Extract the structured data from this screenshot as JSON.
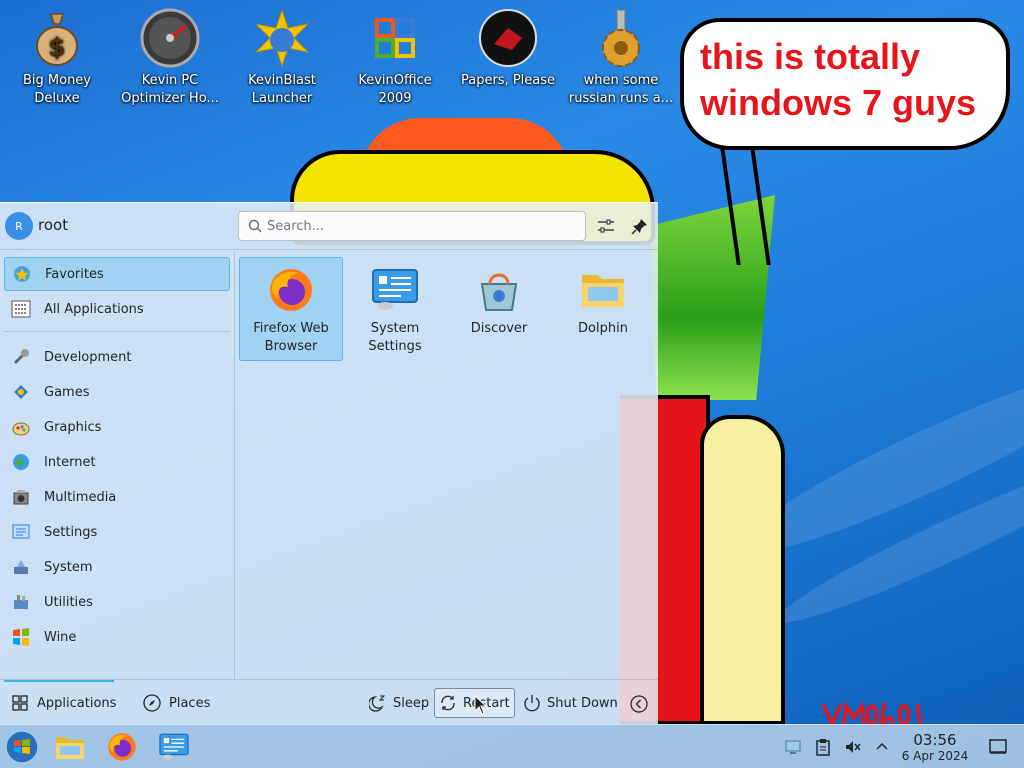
{
  "desktop": {
    "icons": [
      {
        "label": "Big Money\nDeluxe",
        "icon": "money-bag-icon"
      },
      {
        "label": "Kevin PC\nOptimizer Ho...",
        "icon": "gauge-icon"
      },
      {
        "label": "KevinBlast\nLauncher",
        "icon": "sun-star-icon"
      },
      {
        "label": "KevinOffice\n2009",
        "icon": "office-logo-icon"
      },
      {
        "label": "Papers, Please",
        "icon": "papers-please-icon"
      },
      {
        "label": "when some\nrussian runs a...",
        "icon": "gear-icon"
      }
    ],
    "speech_bubble": "this is totally windows 7 guys"
  },
  "menu": {
    "user": {
      "initial": "R",
      "name": "root"
    },
    "search": {
      "placeholder": "Search..."
    },
    "categories": [
      {
        "label": "Favorites",
        "icon": "star-icon",
        "active": true
      },
      {
        "label": "All Applications",
        "icon": "grid-apps-icon"
      },
      {
        "label": "Development",
        "icon": "development-icon"
      },
      {
        "label": "Games",
        "icon": "games-icon"
      },
      {
        "label": "Graphics",
        "icon": "graphics-icon"
      },
      {
        "label": "Internet",
        "icon": "internet-icon"
      },
      {
        "label": "Multimedia",
        "icon": "multimedia-icon"
      },
      {
        "label": "Settings",
        "icon": "settings-icon"
      },
      {
        "label": "System",
        "icon": "system-icon"
      },
      {
        "label": "Utilities",
        "icon": "utilities-icon"
      },
      {
        "label": "Wine",
        "icon": "wine-icon"
      }
    ],
    "favorites": [
      {
        "label": "Firefox Web\nBrowser",
        "icon": "firefox-icon",
        "active": true
      },
      {
        "label": "System\nSettings",
        "icon": "system-settings-icon"
      },
      {
        "label": "Discover",
        "icon": "discover-icon"
      },
      {
        "label": "Dolphin",
        "icon": "folder-icon"
      }
    ],
    "footer": {
      "applications": "Applications",
      "places": "Places",
      "sleep": "Sleep",
      "restart": "Restart",
      "shutdown": "Shut Down"
    }
  },
  "taskbar": {
    "clock_time": "03:56",
    "clock_date": "6 Apr 2024"
  },
  "colors": {
    "accent": "#3daee9",
    "bubble_text": "#e8141c"
  }
}
